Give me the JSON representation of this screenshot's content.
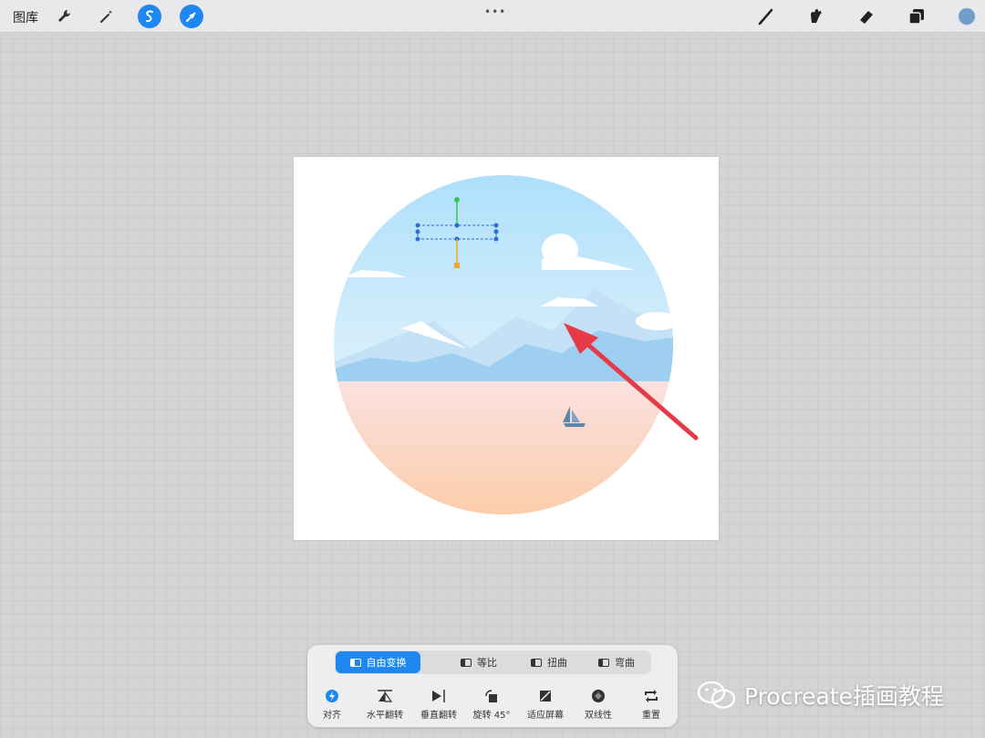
{
  "topbar": {
    "gallery_label": "图库",
    "tools_left": [
      "wrench-icon",
      "magic-wand-icon",
      "selection-s-icon",
      "transform-arrow-icon"
    ],
    "grabber": "•••",
    "tools_right": [
      "brush-icon",
      "smudge-icon",
      "eraser-icon",
      "layers-icon",
      "color-swatch"
    ],
    "current_color": "#6f9ec9",
    "accent": "#1e88f0"
  },
  "transform_toolbar": {
    "modes": [
      "自由变换",
      "等比",
      "扭曲",
      "弯曲"
    ],
    "active_mode": "自由变换",
    "actions": [
      "对齐",
      "水平翻转",
      "垂直翻转",
      "旋转 45°",
      "适应屏幕",
      "双线性",
      "重置"
    ]
  },
  "watermark": {
    "text": "Procreate插画教程"
  },
  "annotation": {
    "arrow_color": "#e53a48"
  }
}
